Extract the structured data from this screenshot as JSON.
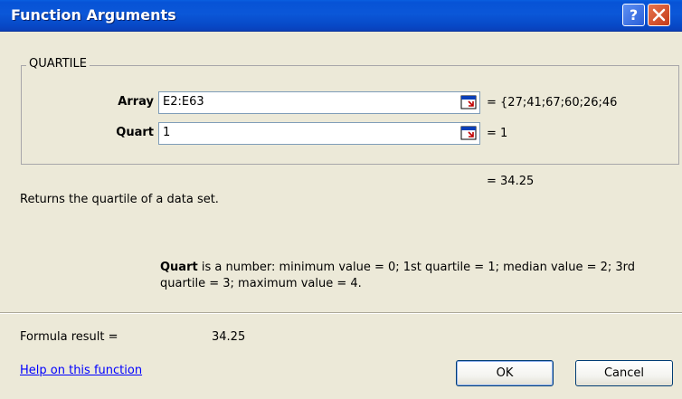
{
  "window": {
    "title": "Function Arguments"
  },
  "group": {
    "label": "QUARTILE"
  },
  "args": [
    {
      "label": "Array",
      "value": "E2:E63",
      "result": "= {27;41;67;60;26;46"
    },
    {
      "label": "Quart",
      "value": "1",
      "result": "= 1"
    }
  ],
  "function_result": "= 34.25",
  "description": "Returns the quartile of a data set.",
  "arg_help": {
    "name": "Quart",
    "text": " is a number: minimum value = 0; 1st quartile = 1; median value = 2; 3rd quartile = 3; maximum value = 4."
  },
  "formula_result": {
    "label": "Formula result =",
    "value": "34.25"
  },
  "help_link": "Help on this function",
  "buttons": {
    "ok": "OK",
    "cancel": "Cancel"
  },
  "icons": {
    "help": "help-icon",
    "close": "close-icon",
    "collapse": "collapse-dialog-icon"
  }
}
